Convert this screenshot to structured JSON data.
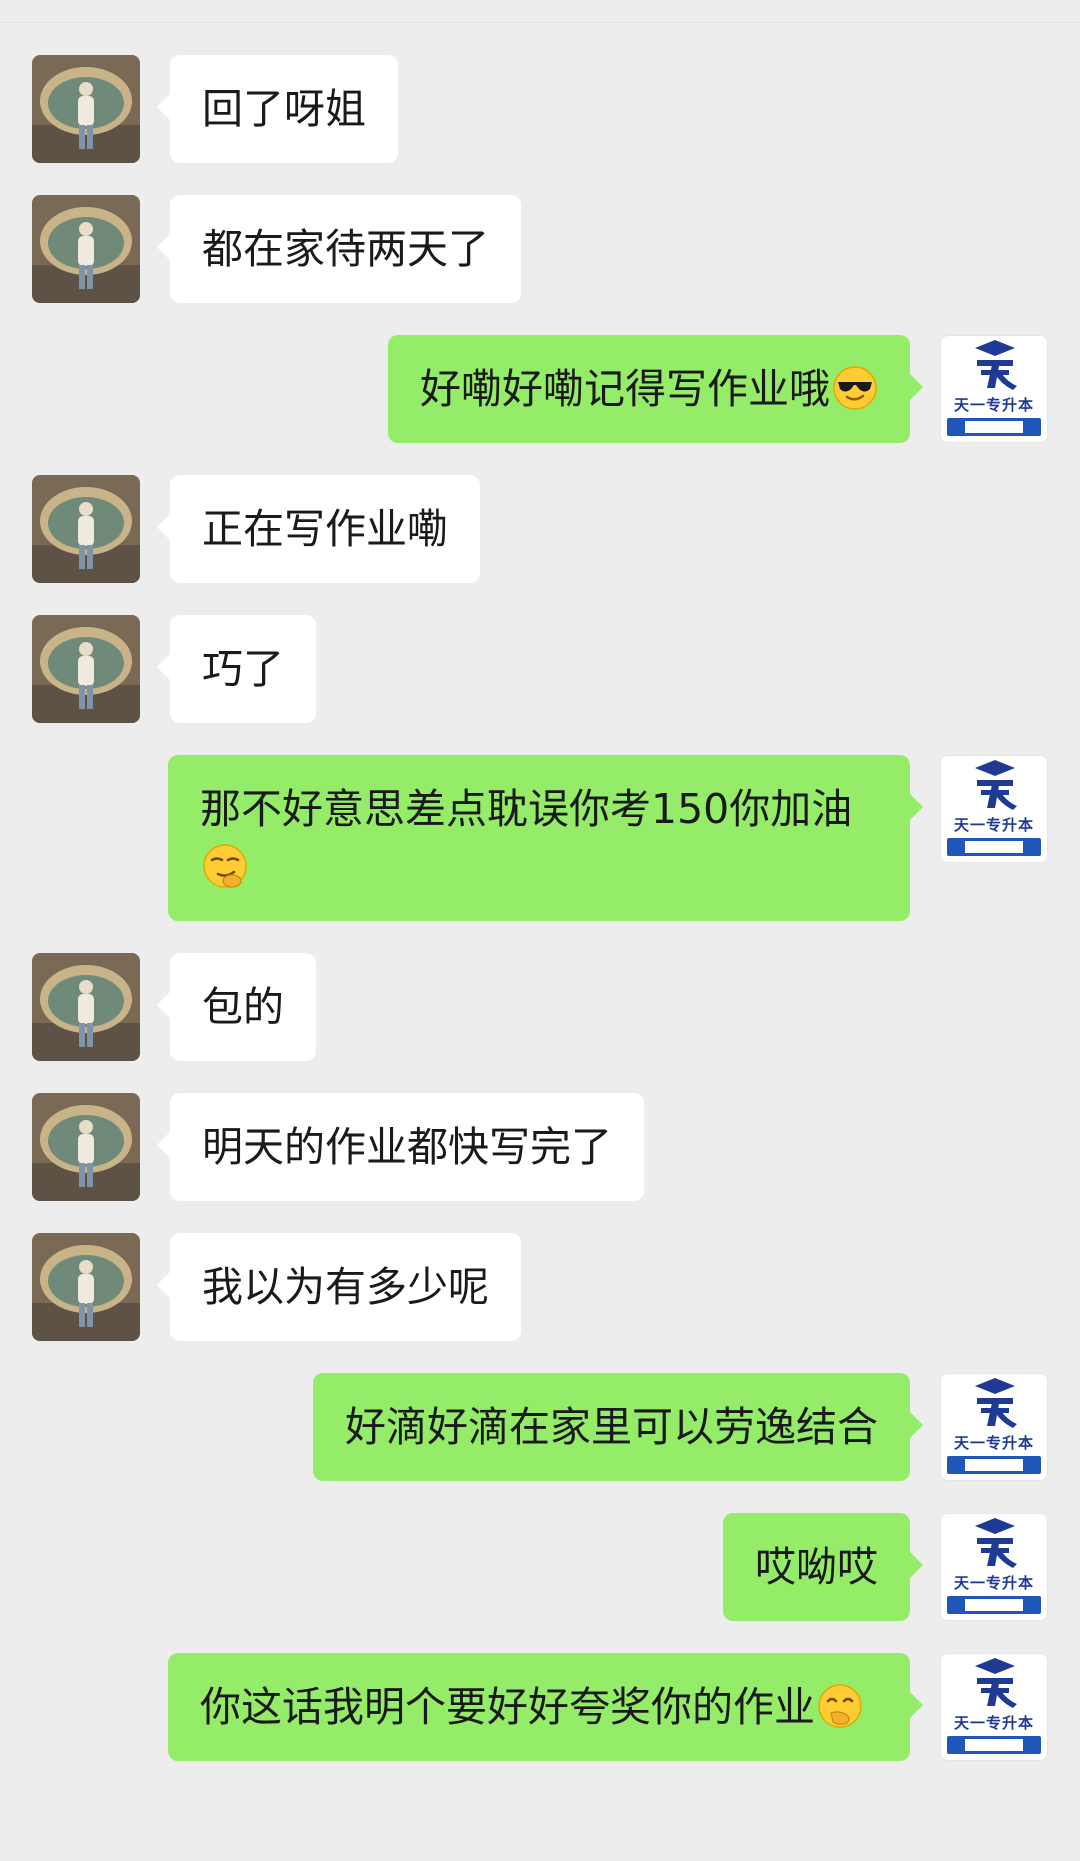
{
  "brand": {
    "name": "天一专升本",
    "color": "#1f3a93",
    "bar_color": "#1f56b8"
  },
  "colors": {
    "background": "#ededed",
    "incoming_bubble": "#ffffff",
    "outgoing_bubble": "#95ec69"
  },
  "messages": [
    {
      "side": "incoming",
      "text": "回了呀姐"
    },
    {
      "side": "incoming",
      "text": "都在家待两天了"
    },
    {
      "side": "outgoing",
      "text": "好嘞好嘞记得写作业哦",
      "emoji": "sunglasses-emoji"
    },
    {
      "side": "incoming",
      "text": "正在写作业嘞"
    },
    {
      "side": "incoming",
      "text": "巧了"
    },
    {
      "side": "outgoing",
      "text": "那不好意思差点耽误你考150你加油",
      "emoji": "smirk-emoji"
    },
    {
      "side": "incoming",
      "text": "包的"
    },
    {
      "side": "incoming",
      "text": "明天的作业都快写完了"
    },
    {
      "side": "incoming",
      "text": "我以为有多少呢"
    },
    {
      "side": "outgoing",
      "text": "好滴好滴在家里可以劳逸结合"
    },
    {
      "side": "outgoing",
      "text": "哎呦哎"
    },
    {
      "side": "outgoing",
      "text": "你这话我明个要好好夸奖你的作业",
      "emoji": "hand-over-mouth-emoji"
    }
  ]
}
